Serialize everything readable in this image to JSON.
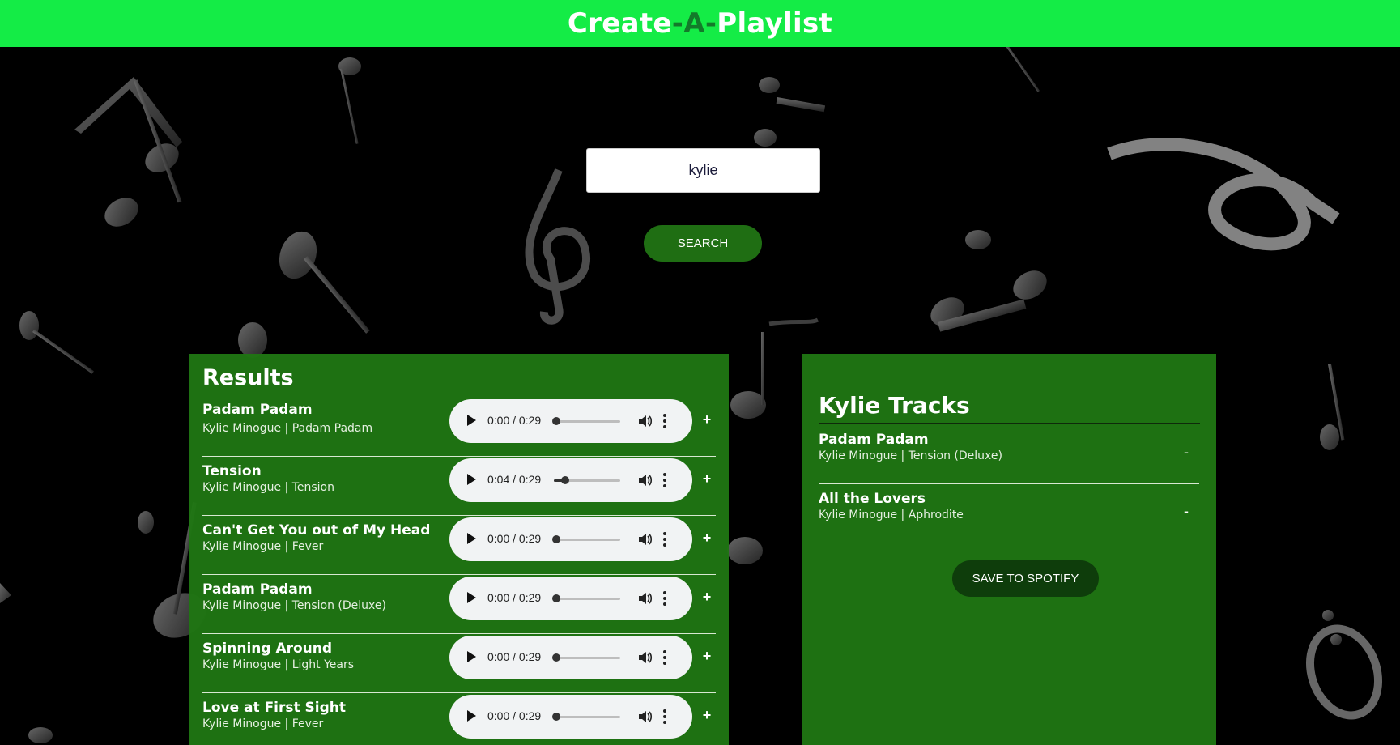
{
  "header": {
    "title_part1": "Create",
    "dash1": "-",
    "title_part2": "A",
    "dash2": "-",
    "title_part3": "Playlist"
  },
  "search": {
    "value": "kylie",
    "button_label": "SEARCH"
  },
  "results": {
    "heading": "Results",
    "add_label": "+",
    "tracks": [
      {
        "title": "Padam Padam",
        "subtitle": "Kylie Minogue | Padam Padam",
        "time": "0:00 / 0:29",
        "progress": 0.0
      },
      {
        "title": "Tension",
        "subtitle": "Kylie Minogue | Tension",
        "time": "0:04 / 0:29",
        "progress": 0.14
      },
      {
        "title": "Can't Get You out of My Head",
        "subtitle": "Kylie Minogue | Fever",
        "time": "0:00 / 0:29",
        "progress": 0.0
      },
      {
        "title": "Padam Padam",
        "subtitle": "Kylie Minogue | Tension (Deluxe)",
        "time": "0:00 / 0:29",
        "progress": 0.0
      },
      {
        "title": "Spinning Around",
        "subtitle": "Kylie Minogue | Light Years",
        "time": "0:00 / 0:29",
        "progress": 0.0
      },
      {
        "title": "Love at First Sight",
        "subtitle": "Kylie Minogue | Fever",
        "time": "0:00 / 0:29",
        "progress": 0.0
      }
    ]
  },
  "playlist": {
    "name": "Kylie Tracks",
    "remove_label": "-",
    "tracks": [
      {
        "title": "Padam Padam",
        "subtitle": "Kylie Minogue | Tension (Deluxe)"
      },
      {
        "title": "All the Lovers",
        "subtitle": "Kylie Minogue | Aphrodite"
      }
    ],
    "save_label": "SAVE TO SPOTIFY"
  },
  "colors": {
    "header_bg": "#14ec46",
    "panel_bg": "#1f7613",
    "button_bg": "#1f6e13",
    "save_bg": "#0e3d0b"
  }
}
